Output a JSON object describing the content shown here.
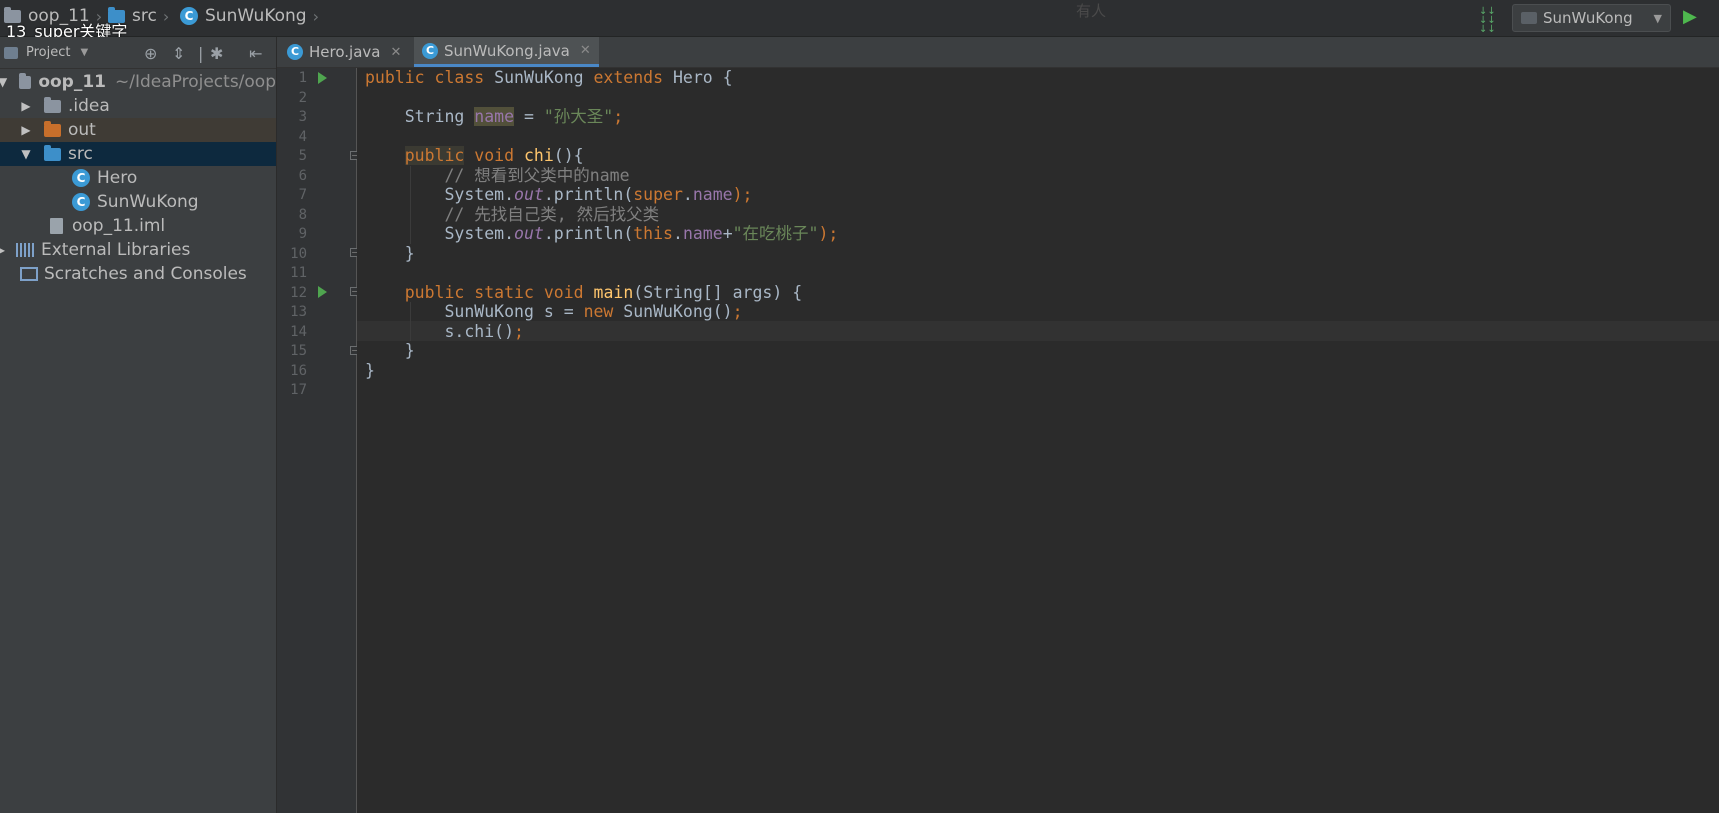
{
  "window": {
    "video_title": "13_super关键字",
    "top_center_text": "有人",
    "breadcrumb": [
      {
        "label": "oop_11",
        "icon": "folder-icon"
      },
      {
        "label": "src",
        "icon": "folder-icon"
      },
      {
        "label": "SunWuKong",
        "icon": "class-icon"
      }
    ],
    "run_config": "SunWuKong"
  },
  "sidebar": {
    "header_label": "Project",
    "tree": [
      {
        "label": "oop_11",
        "extra": "~/IdeaProjects/oop",
        "type": "module"
      },
      {
        "label": ".idea",
        "type": "folder"
      },
      {
        "label": "out",
        "type": "folder-excluded"
      },
      {
        "label": "src",
        "type": "folder-source",
        "selected": true
      },
      {
        "label": "Hero",
        "type": "class"
      },
      {
        "label": "SunWuKong",
        "type": "class"
      },
      {
        "label": "oop_11.iml",
        "type": "file"
      },
      {
        "label": "External Libraries",
        "type": "libraries"
      },
      {
        "label": "Scratches and Consoles",
        "type": "scratches"
      }
    ]
  },
  "tabs": [
    {
      "label": "Hero.java",
      "active": false
    },
    {
      "label": "SunWuKong.java",
      "active": true
    }
  ],
  "editor": {
    "line_numbers": [
      "1",
      "2",
      "3",
      "4",
      "5",
      "6",
      "7",
      "8",
      "9",
      "10",
      "11",
      "12",
      "13",
      "14",
      "15",
      "16",
      "17"
    ],
    "tokens": {
      "l1_public": "public",
      "l1_class": "class",
      "l1_name": "SunWuKong",
      "l1_extends": "extends",
      "l1_rest": "Hero {",
      "l3_type": "String",
      "l3_field": "name",
      "l3_eq": "=",
      "l3_str": "\"孙大圣\"",
      "l3_semi": ";",
      "l5_public": "public",
      "l5_void": "void",
      "l5_fn": "chi",
      "l5_rest": "(){",
      "l6_comment": "// 想看到父类中的name",
      "l7_sys": "System.",
      "l7_out": "out",
      "l7_print": ".println(",
      "l7_super": "super",
      "l7_dot": ".",
      "l7_name": "name",
      "l7_end": ");",
      "l8_comment": "// 先找自己类, 然后找父类",
      "l9_sys": "System.",
      "l9_out": "out",
      "l9_print": ".println(",
      "l9_this": "this",
      "l9_dot": ".",
      "l9_name": "name",
      "l9_plus": "+",
      "l9_str": "\"在吃桃子\"",
      "l9_end": ");",
      "l10_brace": "}",
      "l12_public": "public",
      "l12_static": "static",
      "l12_void": "void",
      "l12_fn": "main",
      "l12_rest": "(String[] args) {",
      "l13_a": "SunWuKong s = ",
      "l13_new": "new",
      "l13_b": " SunWuKong()",
      "l13_semi": ";",
      "l14_a": "s.chi()",
      "l14_semi": ";",
      "l15_brace": "}",
      "l16_brace": "}"
    }
  },
  "colors": {
    "keyword": "#cc7832",
    "function": "#ffc66d",
    "string": "#6a8759",
    "comment": "#808080",
    "field": "#9876aa",
    "selection": "#0d293e"
  }
}
